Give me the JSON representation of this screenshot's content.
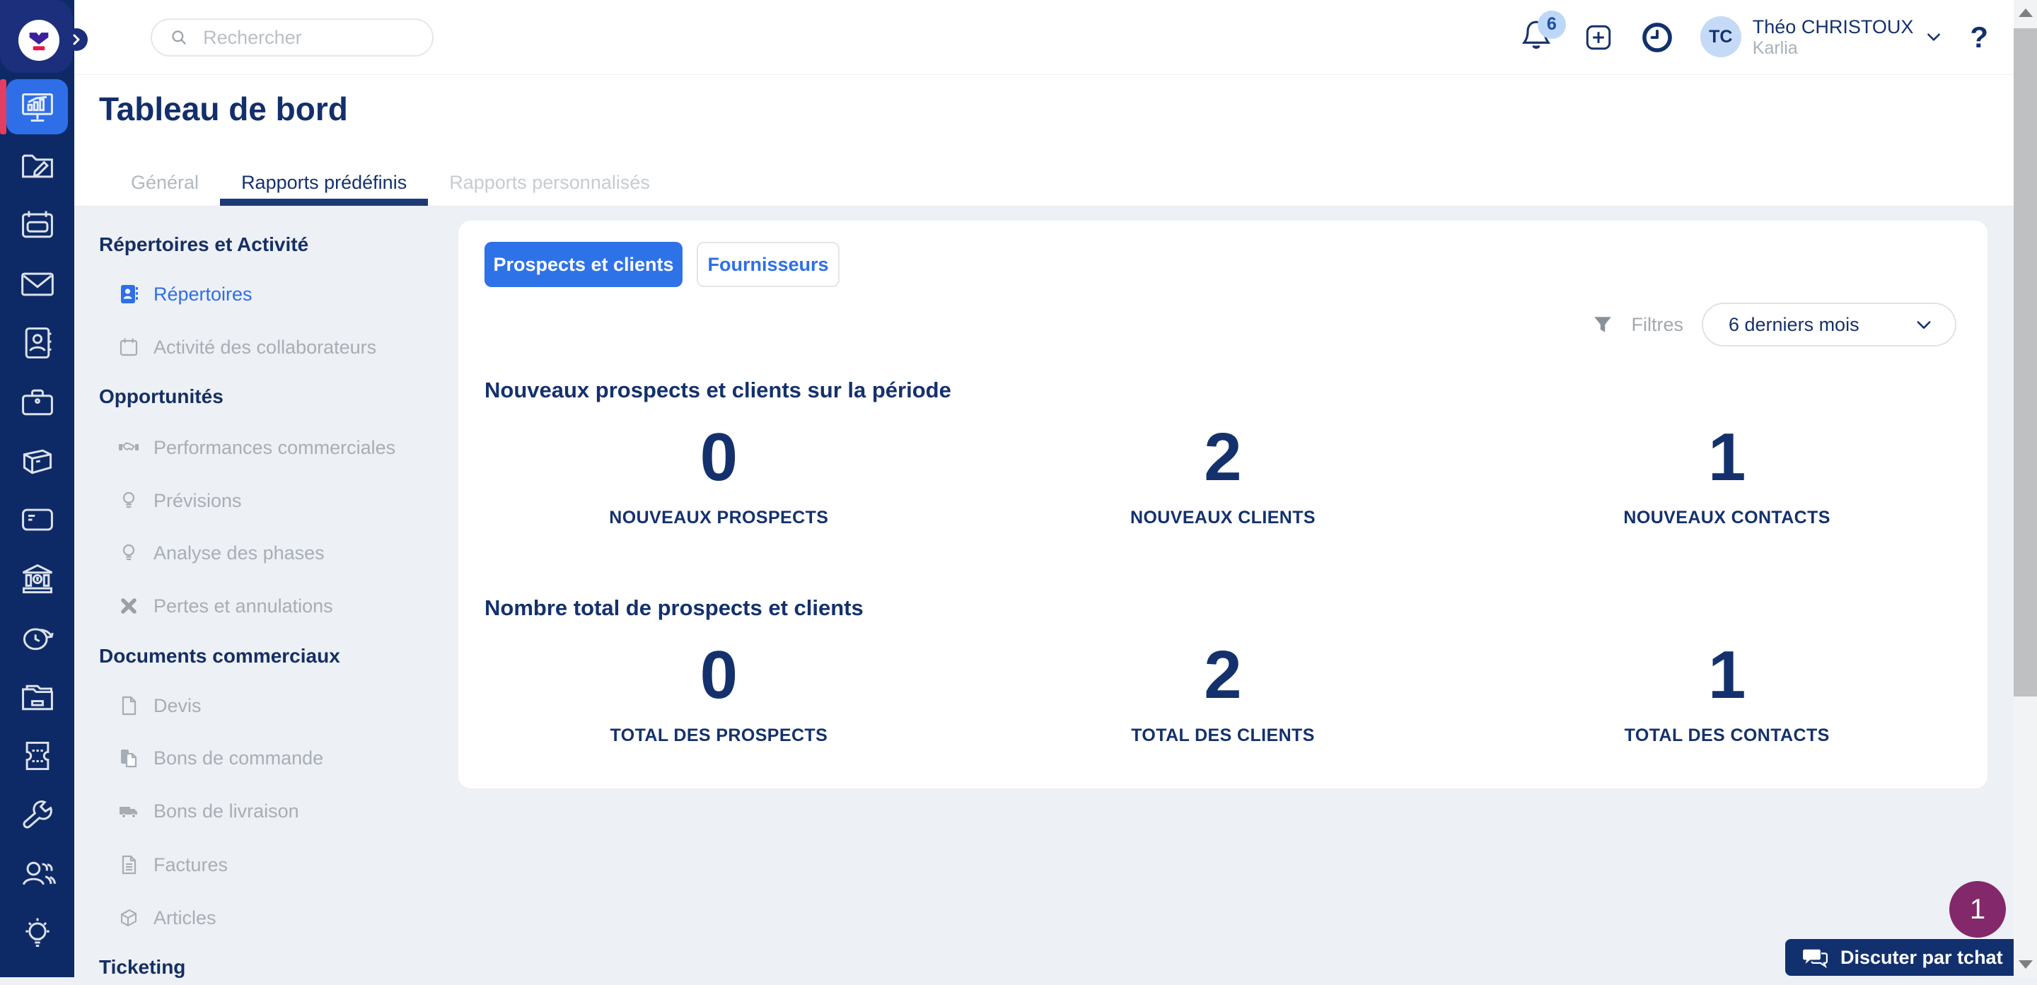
{
  "topbar": {
    "search_placeholder": "Rechercher",
    "notification_count": "6",
    "user_initials": "TC",
    "user_name": "Théo CHRISTOUX",
    "user_company": "Karlia",
    "help_label": "?"
  },
  "page": {
    "title": "Tableau de bord",
    "tabs": [
      {
        "label": "Général",
        "active": false
      },
      {
        "label": "Rapports prédéfinis",
        "active": true
      },
      {
        "label": "Rapports personnalisés",
        "active": false
      }
    ]
  },
  "menu": {
    "sections": [
      {
        "header": "Répertoires et Activité",
        "items": [
          {
            "label": "Répertoires"
          },
          {
            "label": "Activité des collaborateurs"
          }
        ]
      },
      {
        "header": "Opportunités",
        "items": [
          {
            "label": "Performances commerciales"
          },
          {
            "label": "Prévisions"
          },
          {
            "label": "Analyse des phases"
          },
          {
            "label": "Pertes et annulations"
          }
        ]
      },
      {
        "header": "Documents commerciaux",
        "items": [
          {
            "label": "Devis"
          },
          {
            "label": "Bons de commande"
          },
          {
            "label": "Bons de livraison"
          },
          {
            "label": "Factures"
          },
          {
            "label": "Articles"
          }
        ]
      },
      {
        "header": "Ticketing",
        "items": []
      }
    ]
  },
  "content": {
    "audience_buttons": [
      {
        "label": "Prospects et clients",
        "active": true
      },
      {
        "label": "Fournisseurs",
        "active": false
      }
    ],
    "filters_label": "Filtres",
    "period_value": "6 derniers mois",
    "sections": [
      {
        "heading": "Nouveaux prospects et clients sur la période",
        "stats": [
          {
            "value": "0",
            "label": "NOUVEAUX PROSPECTS"
          },
          {
            "value": "2",
            "label": "NOUVEAUX CLIENTS"
          },
          {
            "value": "1",
            "label": "NOUVEAUX CONTACTS"
          }
        ]
      },
      {
        "heading": "Nombre total de prospects et clients",
        "stats": [
          {
            "value": "0",
            "label": "TOTAL DES PROSPECTS"
          },
          {
            "value": "2",
            "label": "TOTAL DES CLIENTS"
          },
          {
            "value": "1",
            "label": "TOTAL DES CONTACTS"
          }
        ]
      }
    ]
  },
  "chat": {
    "label": "Discuter par tchat",
    "badge": "1"
  },
  "colors": {
    "accent_blue": "#2e6fe8",
    "navy_text": "#14316d",
    "sidebar_navy": "#0e2a66",
    "accent_red": "#e23e62",
    "badge_purple": "#83286b",
    "page_bg": "#edf0f5"
  }
}
